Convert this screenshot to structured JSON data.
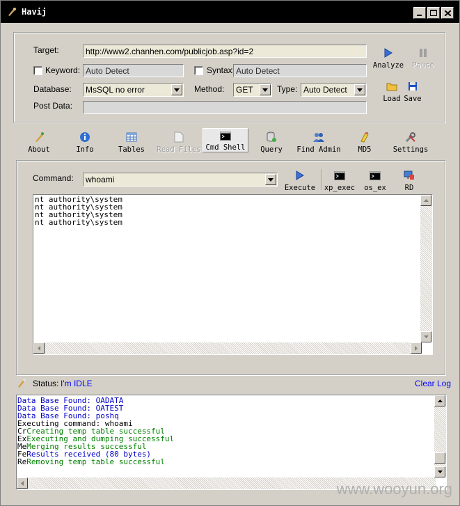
{
  "window": {
    "title": "Havij"
  },
  "target": {
    "label": "Target:",
    "value": "http://www2.chanhen.com/publicjob.asp?id=2",
    "keyword_label": "Keyword:",
    "keyword_value": "Auto Detect",
    "syntax_label": "Syntax:",
    "syntax_value": "Auto Detect",
    "database_label": "Database:",
    "database_value": "MsSQL no error",
    "method_label": "Method:",
    "method_value": "GET",
    "type_label": "Type:",
    "type_value": "Auto Detect",
    "postdata_label": "Post Data:",
    "postdata_value": ""
  },
  "actions": {
    "analyze": "Analyze",
    "pause": "Pause",
    "load": "Load",
    "save": "Save"
  },
  "toolbar": {
    "items": [
      {
        "label": "About",
        "icon": "about-icon"
      },
      {
        "label": "Info",
        "icon": "info-icon"
      },
      {
        "label": "Tables",
        "icon": "tables-icon"
      },
      {
        "label": "Read Files",
        "icon": "read-files-icon"
      },
      {
        "label": "Cmd Shell",
        "icon": "cmd-shell-icon"
      },
      {
        "label": "Query",
        "icon": "query-icon"
      },
      {
        "label": "Find Admin",
        "icon": "find-admin-icon"
      },
      {
        "label": "MD5",
        "icon": "md5-icon"
      },
      {
        "label": "Settings",
        "icon": "settings-icon"
      }
    ]
  },
  "cmd": {
    "label": "Command:",
    "value": "whoami",
    "execute": "Execute",
    "xp_exec": "xp_exec",
    "os_ex": "os_ex",
    "rd": "RD",
    "output": [
      "nt authority\\system",
      "nt authority\\system",
      "nt authority\\system",
      "nt authority\\system"
    ]
  },
  "status": {
    "label": "Status:",
    "value": "I'm IDLE",
    "clear_log": "Clear Log"
  },
  "log": {
    "lines": [
      {
        "prefix": "",
        "text": "Data Base Found: OADATA",
        "color": "blue"
      },
      {
        "prefix": "",
        "text": "Data Base Found: OATEST",
        "color": "blue"
      },
      {
        "prefix": "",
        "text": "Data Base Found: poshq",
        "color": "blue"
      },
      {
        "prefix": "",
        "text": "Executing command: whoami",
        "color": "black"
      },
      {
        "prefix": "Cr",
        "text": "Creating temp table successful",
        "color": "green"
      },
      {
        "prefix": "Ex",
        "text": "Executing and dumping successful",
        "color": "green"
      },
      {
        "prefix": "Me",
        "text": "Merging results successful",
        "color": "green"
      },
      {
        "prefix": "Fe",
        "text": "Results received (80 bytes)",
        "color": "blue"
      },
      {
        "prefix": "Re",
        "text": "Removing temp table successful",
        "color": "green"
      }
    ]
  },
  "watermark": "www.wooyun.org"
}
